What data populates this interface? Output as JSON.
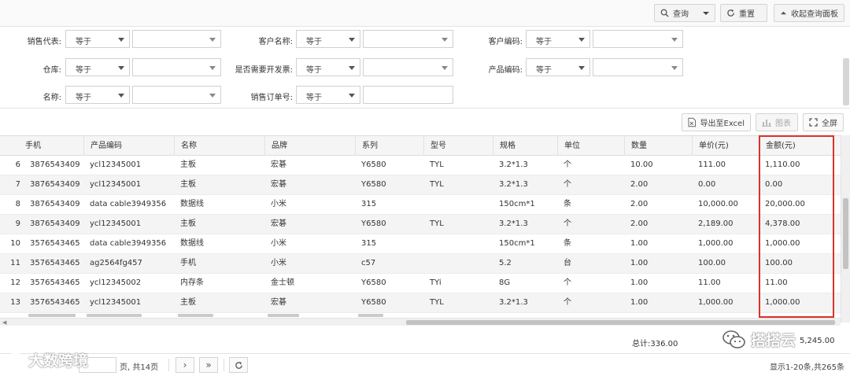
{
  "toolbar": {
    "query_label": "查询",
    "reset_label": "重置",
    "collapse_label": "收起查询面板"
  },
  "filters": [
    {
      "label": "销售代表:",
      "op": "等于",
      "value": ""
    },
    {
      "label": "客户名称:",
      "op": "等于",
      "value": ""
    },
    {
      "label": "客户编码:",
      "op": "等于",
      "value": ""
    },
    {
      "label": "仓库:",
      "op": "等于",
      "value": ""
    },
    {
      "label": "是否需要开发票:",
      "op": "等于",
      "value": ""
    },
    {
      "label": "产品编码:",
      "op": "等于",
      "value": ""
    },
    {
      "label": "名称:",
      "op": "等于",
      "value": ""
    },
    {
      "label": "销售订单号:",
      "op": "等于",
      "value": ""
    }
  ],
  "grid_tools": {
    "export_label": "导出至Excel",
    "chart_label": "图表",
    "fullscreen_label": "全屏"
  },
  "table": {
    "columns": [
      "手机",
      "产品编码",
      "名称",
      "品牌",
      "系列",
      "型号",
      "规格",
      "单位",
      "数量",
      "单价(元)",
      "金额(元)"
    ],
    "rows": [
      {
        "n": "6",
        "cells": [
          "3876543409",
          "ycl12345001",
          "主板",
          "宏碁",
          "Y6580",
          "TYL",
          "3.2*1.3",
          "个",
          "10.00",
          "111.00",
          "1,110.00"
        ]
      },
      {
        "n": "7",
        "cells": [
          "3876543409",
          "ycl12345001",
          "主板",
          "宏碁",
          "Y6580",
          "TYL",
          "3.2*1.3",
          "个",
          "2.00",
          "0.00",
          "0.00"
        ]
      },
      {
        "n": "8",
        "cells": [
          "3876543409",
          "data cable3949356",
          "数据线",
          "小米",
          "315",
          "",
          "150cm*1",
          "条",
          "2.00",
          "10,000.00",
          "20,000.00"
        ]
      },
      {
        "n": "9",
        "cells": [
          "3876543409",
          "ycl12345001",
          "主板",
          "宏碁",
          "Y6580",
          "TYL",
          "3.2*1.3",
          "个",
          "2.00",
          "2,189.00",
          "4,378.00"
        ]
      },
      {
        "n": "10",
        "cells": [
          "3576543465",
          "data cable3949356",
          "数据线",
          "小米",
          "315",
          "",
          "150cm*1",
          "条",
          "1.00",
          "1,000.00",
          "1,000.00"
        ]
      },
      {
        "n": "11",
        "cells": [
          "3576543465",
          "ag2564fg457",
          "手机",
          "小米",
          "c57",
          "",
          "5.2",
          "台",
          "1.00",
          "100.00",
          "100.00"
        ]
      },
      {
        "n": "12",
        "cells": [
          "3576543465",
          "ycl12345002",
          "内存条",
          "金士顿",
          "Y6580",
          "TYi",
          "8G",
          "个",
          "1.00",
          "11.00",
          "11.00"
        ]
      },
      {
        "n": "13",
        "cells": [
          "3576543465",
          "ycl12345001",
          "主板",
          "宏碁",
          "Y6580",
          "TYL",
          "3.2*1.3",
          "个",
          "1.00",
          "1,000.00",
          "1,000.00"
        ]
      }
    ],
    "highlighted_column": "金额(元)"
  },
  "summary": {
    "qty_total": "总计:336.00",
    "amount_total": "5,245.00"
  },
  "pager": {
    "page_text": "页, 共14页",
    "range_text": "显示1-20条,共265条"
  },
  "watermarks": {
    "left": "大数跨境",
    "right": "搭搭云"
  },
  "colors": {
    "highlight_border": "#d9322a",
    "alt_row_bg": "#f4f4f4"
  }
}
